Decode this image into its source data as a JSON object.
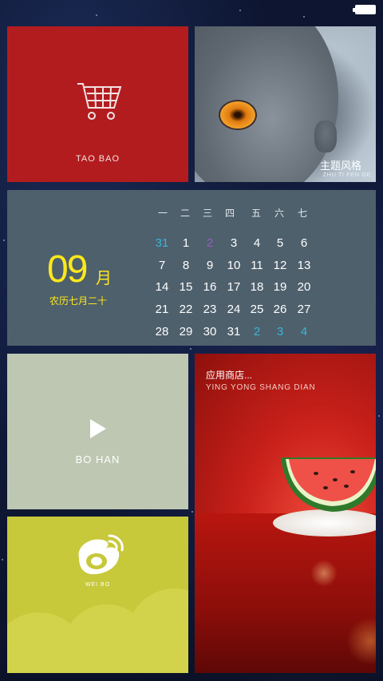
{
  "status_bar": {
    "battery_icon": "battery-icon"
  },
  "tiles": {
    "taobao": {
      "label": "TAO BAO",
      "icon": "shopping-cart-icon",
      "color": "#b31c1f"
    },
    "theme": {
      "title_cn": "主题风格",
      "title_pinyin": "ZHU TI FEN GE",
      "image": "gray-cat-photo"
    },
    "calendar": {
      "month_number": "09",
      "month_unit": "月",
      "lunar_date": "农历七月二十",
      "weekdays": [
        "一",
        "二",
        "三",
        "四",
        "五",
        "六",
        "七"
      ],
      "weeks": [
        [
          {
            "d": "31",
            "other": true
          },
          {
            "d": "1"
          },
          {
            "d": "2",
            "today": true
          },
          {
            "d": "3"
          },
          {
            "d": "4"
          },
          {
            "d": "5"
          },
          {
            "d": "6"
          }
        ],
        [
          {
            "d": "7"
          },
          {
            "d": "8"
          },
          {
            "d": "9"
          },
          {
            "d": "10"
          },
          {
            "d": "11"
          },
          {
            "d": "12"
          },
          {
            "d": "13"
          }
        ],
        [
          {
            "d": "14"
          },
          {
            "d": "15"
          },
          {
            "d": "16"
          },
          {
            "d": "17"
          },
          {
            "d": "18"
          },
          {
            "d": "19"
          },
          {
            "d": "20"
          }
        ],
        [
          {
            "d": "21"
          },
          {
            "d": "22"
          },
          {
            "d": "23"
          },
          {
            "d": "24"
          },
          {
            "d": "25"
          },
          {
            "d": "26"
          },
          {
            "d": "27"
          }
        ],
        [
          {
            "d": "28"
          },
          {
            "d": "29"
          },
          {
            "d": "30"
          },
          {
            "d": "31"
          },
          {
            "d": "2",
            "other": true
          },
          {
            "d": "3",
            "other": true
          },
          {
            "d": "4",
            "other": true
          }
        ]
      ],
      "accent_color": "#ffe81a",
      "other_month_color": "#37b6d6"
    },
    "video": {
      "label": "BO  HAN",
      "icon": "play-icon",
      "color": "#bdc7b2"
    },
    "store": {
      "title_cn": "应用商店...",
      "title_pinyin": "YING YONG SHANG DIAN",
      "image": "watermelon-photo"
    },
    "weibo": {
      "label": "WEI BO",
      "icon": "weibo-logo-icon",
      "color": "#c7c83a"
    }
  }
}
